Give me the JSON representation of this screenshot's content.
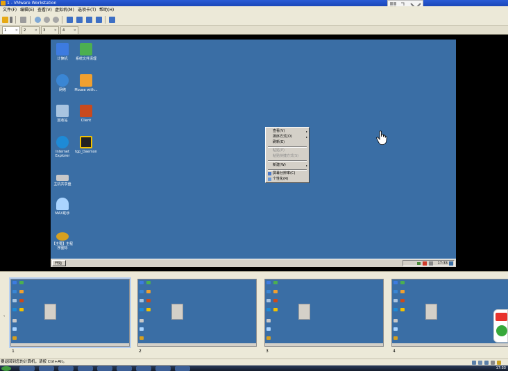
{
  "window": {
    "title": "1 - VMware Workstation"
  },
  "menu": [
    "文件(F)",
    "编辑(E)",
    "查看(V)",
    "虚拟机(M)",
    "选项卡(T)",
    "帮助(H)"
  ],
  "tabs": [
    {
      "label": "1",
      "active": true
    },
    {
      "label": "2",
      "active": false
    },
    {
      "label": "3",
      "active": false
    },
    {
      "label": "4",
      "active": false
    }
  ],
  "desktop": {
    "icons": [
      {
        "label": "计算机",
        "icon": "computer-icon",
        "color": "#3d7be0"
      },
      {
        "label": "系统文件清理",
        "icon": "broom-icon",
        "color": "#4caf50"
      },
      {
        "label": "网络",
        "icon": "network-icon",
        "color": "#3a86d4"
      },
      {
        "label": "Mouse with...",
        "icon": "mouse-share-icon",
        "color": "#f0a030"
      },
      {
        "label": "回收站",
        "icon": "recycle-bin-icon",
        "color": "#a8c4e0"
      },
      {
        "label": "Client",
        "icon": "client-icon",
        "color": "#c84a1e"
      },
      {
        "label": "Internet Explorer",
        "icon": "ie-icon",
        "color": "#1e8ad6"
      },
      {
        "label": "tgp_Daemon",
        "icon": "game-launcher-icon",
        "color": "#f2c200"
      },
      {
        "label": "主机共享盘",
        "icon": "drive-icon",
        "color": "#c8c8c8"
      },
      {
        "label": "MAX助手",
        "icon": "max-assistant-icon",
        "color": "#aad4ff"
      },
      {
        "label": "【主要】主程序图标",
        "icon": "main-program-icon",
        "color": "#d6a020"
      }
    ],
    "taskbar": {
      "start_label": "开始",
      "clock": "17:33"
    }
  },
  "context_menu": {
    "items": [
      {
        "label": "查看(V)",
        "submenu": true,
        "disabled": false
      },
      {
        "label": "排序方式(O)",
        "submenu": true,
        "disabled": false
      },
      {
        "label": "刷新(E)",
        "submenu": false,
        "disabled": false
      },
      {
        "type": "separator"
      },
      {
        "label": "粘贴(P)",
        "submenu": false,
        "disabled": true
      },
      {
        "label": "粘贴快捷方式(S)",
        "submenu": false,
        "disabled": true
      },
      {
        "type": "separator"
      },
      {
        "label": "新建(W)",
        "submenu": true,
        "disabled": false
      },
      {
        "type": "separator"
      },
      {
        "label": "屏幕分辨率(C)",
        "submenu": false,
        "disabled": false,
        "icon": "display-icon"
      },
      {
        "label": "个性化(R)",
        "submenu": false,
        "disabled": false,
        "icon": "personalize-icon"
      }
    ]
  },
  "thumbnails": [
    {
      "label": "1",
      "selected": true
    },
    {
      "label": "2",
      "selected": false
    },
    {
      "label": "3",
      "selected": false
    },
    {
      "label": "4",
      "selected": false
    }
  ],
  "status": {
    "text": "要返回到您的计算机，请按 Ctrl+Alt。"
  },
  "host_taskbar": {
    "clock": "17:33"
  },
  "colors": {
    "desktop": "#3a6ea5",
    "title_bar": "#1a47b8",
    "chrome": "#ece9d8"
  }
}
